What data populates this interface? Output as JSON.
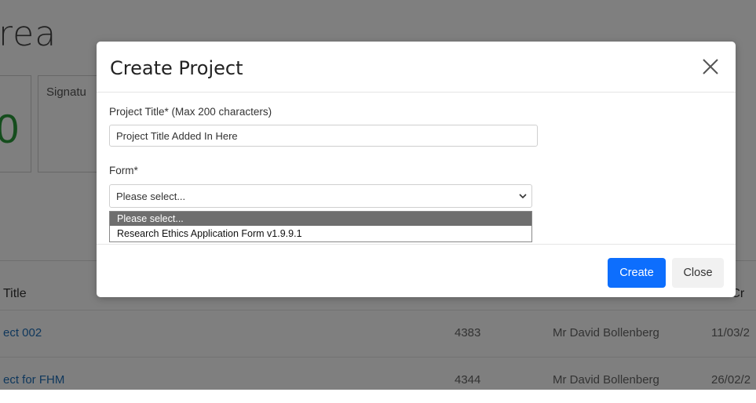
{
  "background": {
    "heading": "rea",
    "card_label": "Signatu",
    "card_value": "0",
    "table": {
      "header_title": "Title",
      "header_date": "e Cr",
      "rows": [
        {
          "title": "ect 002",
          "id": "4383",
          "user": "Mr David Bollenberg",
          "date": "11/03/2"
        },
        {
          "title": "ect for FHM",
          "id": "4344",
          "user": "Mr David Bollenberg",
          "date": "26/02/2"
        }
      ]
    }
  },
  "modal": {
    "title": "Create Project",
    "title_field": {
      "label": "Project Title* (Max 200 characters)",
      "value": "Project Title Added In Here"
    },
    "form_field": {
      "label": "Form*",
      "selected": "Please select...",
      "options": [
        "Please select...",
        "Research Ethics Application Form v1.9.9.1"
      ]
    },
    "buttons": {
      "create": "Create",
      "close": "Close"
    }
  },
  "colors": {
    "primary": "#0d6efd",
    "link": "#1f6fb8",
    "highlight": "#6e6e6e"
  }
}
